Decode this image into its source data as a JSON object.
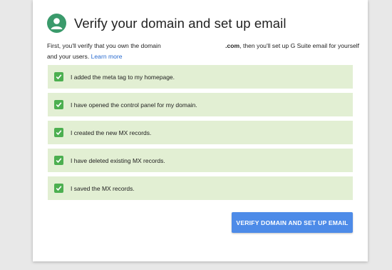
{
  "dialog": {
    "title": "Verify your domain and set up email",
    "avatar_icon": "person-icon",
    "avatar_color": "#3a9a6b"
  },
  "intro": {
    "text_before": "First, you'll verify that you own the domain",
    "domain_suffix": ".com",
    "text_after": ", then you'll set up G Suite email for yourself and your users.",
    "learn_more_label": "Learn more"
  },
  "checklist": {
    "items": [
      {
        "label": "I added the meta tag to my homepage.",
        "checked": true
      },
      {
        "label": "I have opened the control panel for my domain.",
        "checked": true
      },
      {
        "label": "I created the new MX records.",
        "checked": true
      },
      {
        "label": "I have deleted existing MX records.",
        "checked": true
      },
      {
        "label": "I saved the MX records.",
        "checked": true
      }
    ],
    "item_background": "#e2efd3",
    "check_color": "#4caf50"
  },
  "actions": {
    "verify_label": "VERIFY DOMAIN AND SET UP EMAIL",
    "verify_color": "#4d8be8"
  }
}
